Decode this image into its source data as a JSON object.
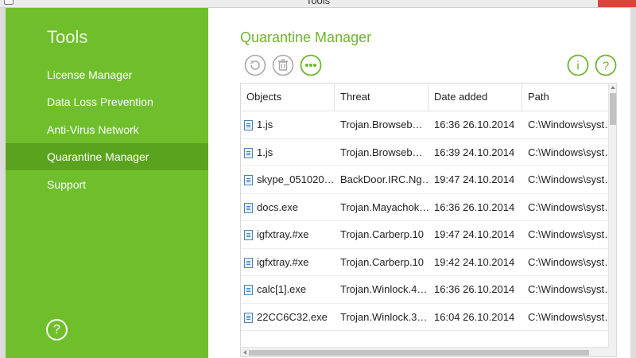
{
  "window": {
    "title": "Tools"
  },
  "sidebar": {
    "heading": "Tools",
    "items": [
      {
        "label": "License Manager",
        "active": false
      },
      {
        "label": "Data Loss Prevention",
        "active": false
      },
      {
        "label": "Anti-Virus Network",
        "active": false
      },
      {
        "label": "Quarantine Manager",
        "active": true
      },
      {
        "label": "Support",
        "active": false
      }
    ],
    "help_symbol": "?"
  },
  "main": {
    "title": "Quarantine Manager",
    "toolbar": {
      "left": [
        "restore-icon",
        "delete-icon",
        "more-icon"
      ],
      "right": [
        "info-icon",
        "help-icon"
      ],
      "info_symbol": "i",
      "help_symbol": "?"
    }
  },
  "table": {
    "columns": [
      "Objects",
      "Threat",
      "Date added",
      "Path"
    ],
    "rows": [
      [
        "1.js",
        "Trojan.Browseb…",
        "16:36 26.10.2014",
        "C:\\Windows\\syst…"
      ],
      [
        "1.js",
        "Trojan.Browseb…",
        "16:39 24.10.2014",
        "C:\\Windows\\syst…"
      ],
      [
        "skype_051020…",
        "BackDoor.IRC.Ng…",
        "19:47 24.10.2014",
        "C:\\Windows\\syst…"
      ],
      [
        "docs.exe",
        "Trojan.Mayachok…",
        "16:36 26.10.2014",
        "C:\\Windows\\syst…"
      ],
      [
        "igfxtray.#xe",
        "Trojan.Carberp.10",
        "19:47 24.10.2014",
        "C:\\Windows\\syst…"
      ],
      [
        "igfxtray.#xe",
        "Trojan.Carberp.10",
        "19:42 24.10.2014",
        "C:\\Windows\\syst…"
      ],
      [
        "calc[1].exe",
        "Trojan.Winlock.4…",
        "16:36 26.10.2014",
        "C:\\Windows\\syst…"
      ],
      [
        "22CC6C32.exe",
        "Trojan.Winlock.3…",
        "16:04 26.10.2014",
        "C:\\Windows\\syst…"
      ]
    ]
  },
  "colors": {
    "sidebar_bg": "#6fbf2c",
    "sidebar_active": "#5aa31e",
    "accent": "#6cb52e",
    "toolbar_disabled": "#a9a9a9"
  }
}
